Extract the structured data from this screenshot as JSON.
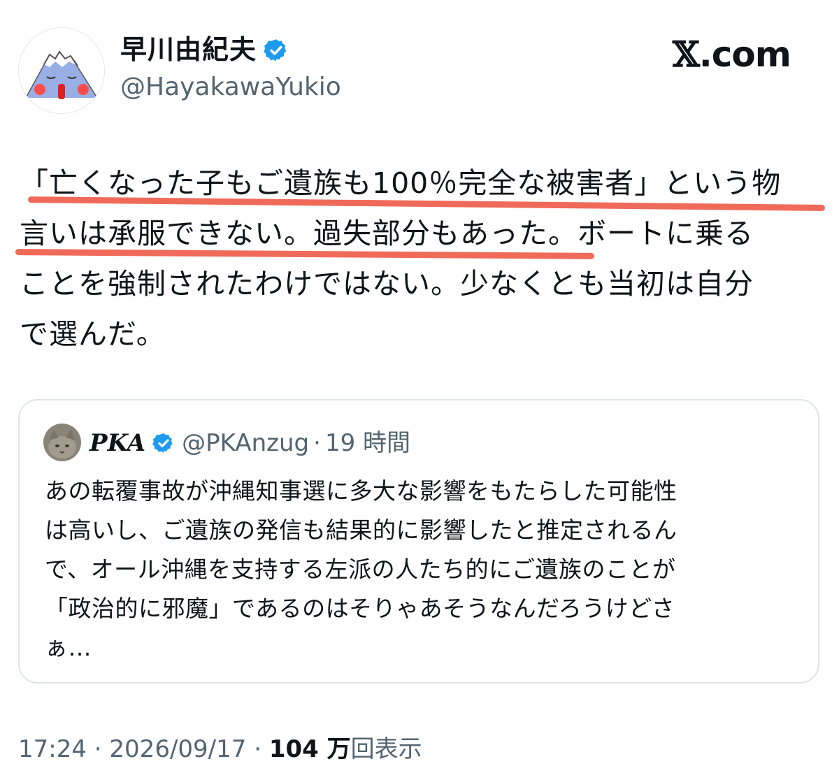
{
  "author": {
    "display_name": "早川由紀夫",
    "handle": "@HayakawaYukio",
    "avatar_icon": "mountain-face-avatar",
    "verified_icon": "verified-badge-icon"
  },
  "brand": {
    "x_glyph": "𝕏",
    "domain": ".com"
  },
  "tweet": {
    "lines": [
      "「亡くなった子もご遺族も100％完全な被害者」という物",
      "言いは承服できない。過失部分もあった。ボートに乗る",
      "ことを強制されたわけではない。少なくとも当初は自分",
      "で選んだ。"
    ]
  },
  "quote": {
    "name": "PKA",
    "handle": "@PKAnzug",
    "separator": "·",
    "time": "19 時間",
    "lines": [
      "あの転覆事故が沖縄知事選に多大な影響をもたらした可能性",
      "は高いし、ご遺族の発信も結果的に影響したと推定されるん",
      "で、オール沖縄を支持する左派の人たち的にご遺族のことが",
      "「政治的に邪魔」であるのはそりゃあそうなんだろうけどさ",
      "ぁ…"
    ]
  },
  "meta": {
    "time": "17:24",
    "sep1": " · ",
    "date": "2026/09/17",
    "sep2": " · ",
    "count": "104 万",
    "label": "回表示"
  },
  "colors": {
    "verified": "#1d9bf0",
    "underline": "#f06a5a",
    "muted": "#536471"
  }
}
